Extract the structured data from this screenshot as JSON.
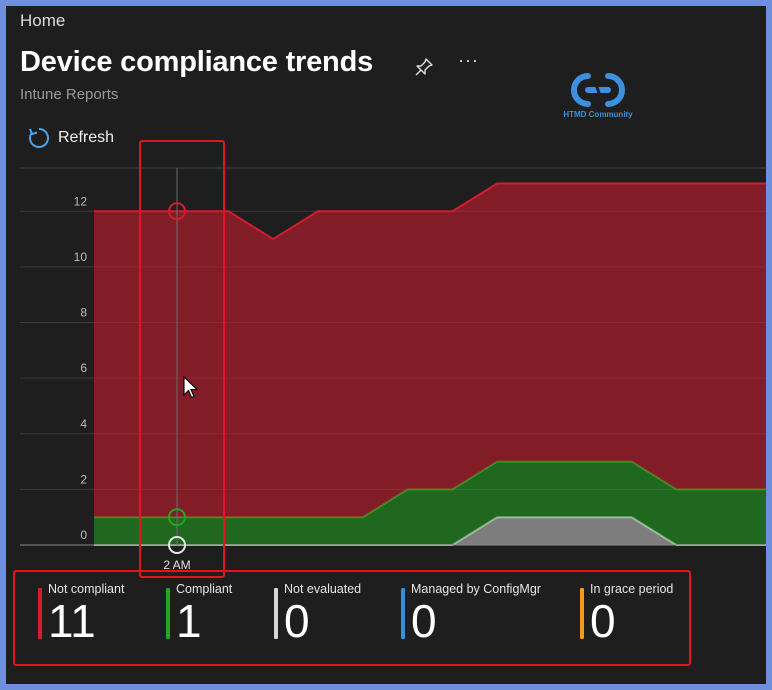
{
  "breadcrumb": "Home",
  "header": {
    "title": "Device compliance trends",
    "subtitle": "Intune Reports",
    "more_label": "···"
  },
  "logo": {
    "text": "HTMD Community"
  },
  "toolbar": {
    "refresh_label": "Refresh"
  },
  "chart_data": {
    "type": "area",
    "stacked": true,
    "y_ticks": [
      "0",
      "2",
      "4",
      "6",
      "8",
      "10",
      "12"
    ],
    "ylim": [
      0,
      13.7
    ],
    "x_tick_labels": [
      "2 AM"
    ],
    "hover_label": "2 AM",
    "grid": true,
    "series": [
      {
        "name": "Not evaluated",
        "color": "#bdbdbd",
        "values": [
          0,
          0,
          0,
          0,
          0,
          0,
          0,
          0,
          0,
          1,
          1,
          1,
          1,
          0,
          0,
          0
        ]
      },
      {
        "name": "Compliant",
        "color": "#22a522",
        "values": [
          1,
          1,
          1,
          1,
          1,
          1,
          1,
          2,
          2,
          2,
          2,
          2,
          2,
          2,
          2,
          2
        ]
      },
      {
        "name": "Not compliant",
        "color": "#d51c2e",
        "values": [
          11,
          11,
          11,
          11,
          10,
          11,
          11,
          10,
          10,
          10,
          10,
          10,
          10,
          11,
          11,
          11
        ]
      }
    ]
  },
  "legend": [
    {
      "label": "Not compliant",
      "value": "11",
      "color": "#d51c2e"
    },
    {
      "label": "Compliant",
      "value": "1",
      "color": "#22a522"
    },
    {
      "label": "Not evaluated",
      "value": "0",
      "color": "#d6d6d6"
    },
    {
      "label": "Managed by ConfigMgr",
      "value": "0",
      "color": "#2f8fe0"
    },
    {
      "label": "In grace period",
      "value": "0",
      "color": "#f39a1f"
    }
  ]
}
